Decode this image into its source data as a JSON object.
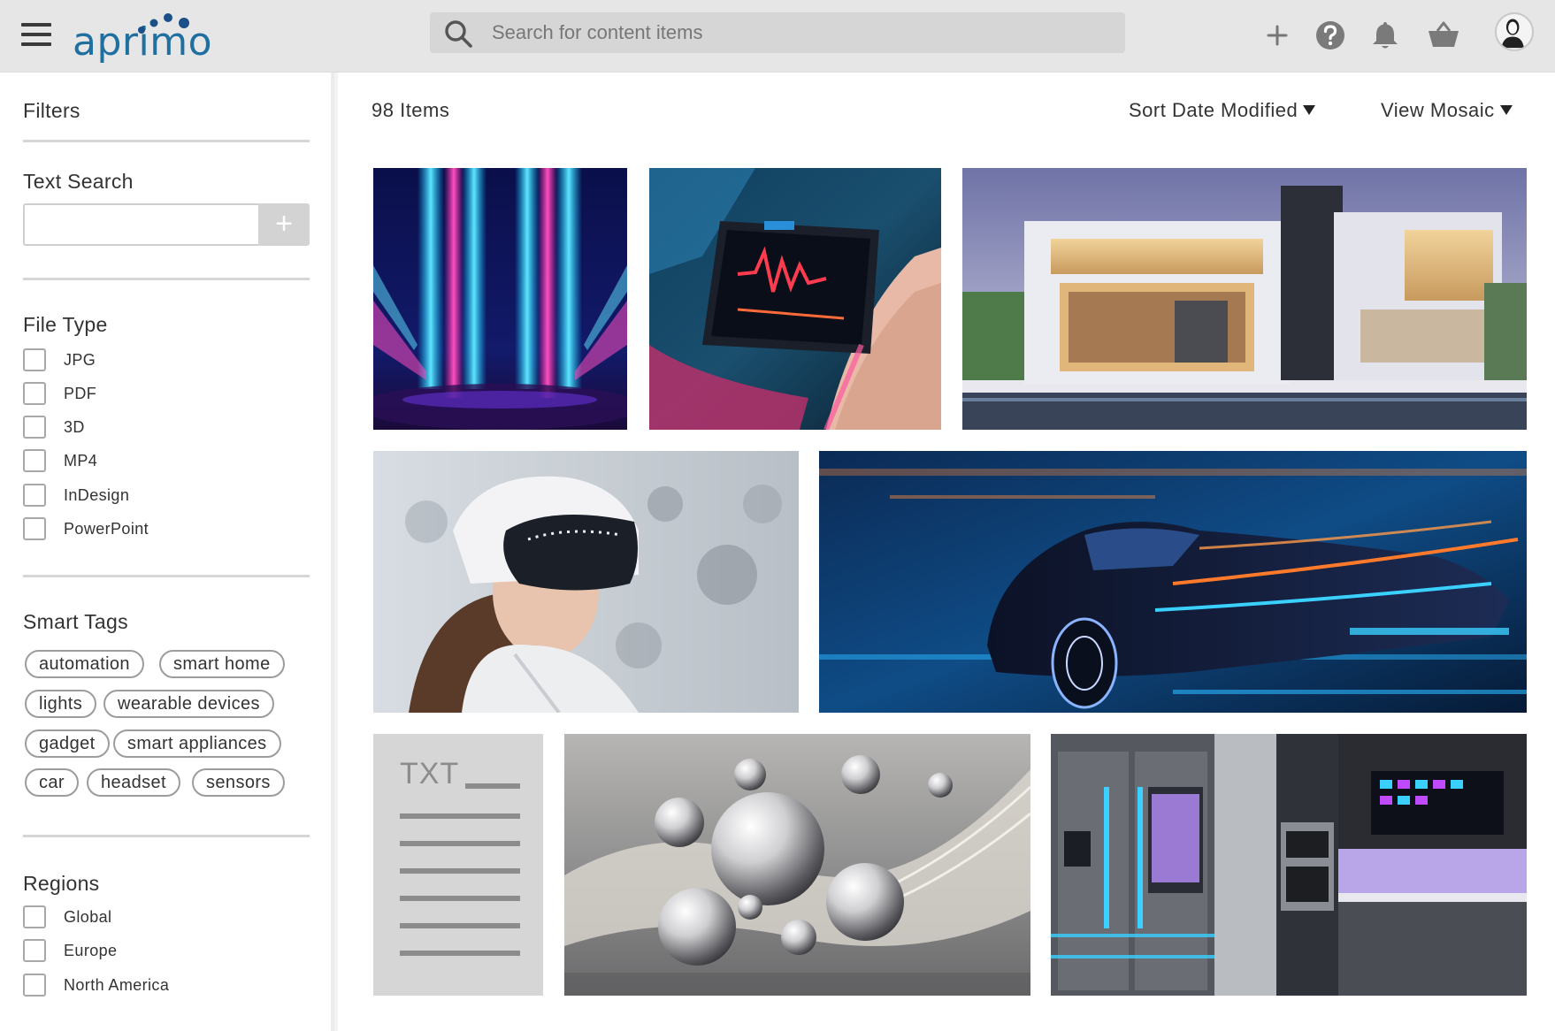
{
  "header": {
    "brand": "aprimo",
    "search_placeholder": "Search for content items"
  },
  "icons": {
    "menu": "hamburger-icon",
    "search": "search-icon",
    "add": "plus-icon",
    "help": "help-icon",
    "notifications": "bell-icon",
    "basket": "basket-icon",
    "profile": "avatar"
  },
  "sidebar": {
    "filters_title": "Filters",
    "text_search": {
      "title": "Text Search",
      "value": "",
      "add_label": "+"
    },
    "file_type": {
      "title": "File Type",
      "options": [
        "JPG",
        "PDF",
        "3D",
        "MP4",
        "InDesign",
        "PowerPoint"
      ]
    },
    "smart_tags": {
      "title": "Smart Tags",
      "tags": [
        "automation",
        "smart home",
        "lights",
        "wearable devices",
        "gadget",
        "smart appliances",
        "car",
        "headset",
        "sensors"
      ]
    },
    "regions": {
      "title": "Regions",
      "options": [
        "Global",
        "Europe",
        "North America"
      ]
    }
  },
  "main": {
    "item_count": "98 Items",
    "sort_label": "Sort Date Modified",
    "view_label": "View Mosaic",
    "tiles": [
      {
        "kind": "neon-lights"
      },
      {
        "kind": "smartwatch"
      },
      {
        "kind": "modern-house"
      },
      {
        "kind": "vr-headset"
      },
      {
        "kind": "electric-car"
      },
      {
        "kind": "txt-document",
        "label": "TXT"
      },
      {
        "kind": "glass-spheres"
      },
      {
        "kind": "smart-kitchen"
      }
    ]
  },
  "colors": {
    "brand_blue": "#1f6fa0",
    "brand_dots": "#1b4f8a",
    "topbar_bg": "#e6e6e6",
    "search_bg": "#d6d6d6"
  }
}
